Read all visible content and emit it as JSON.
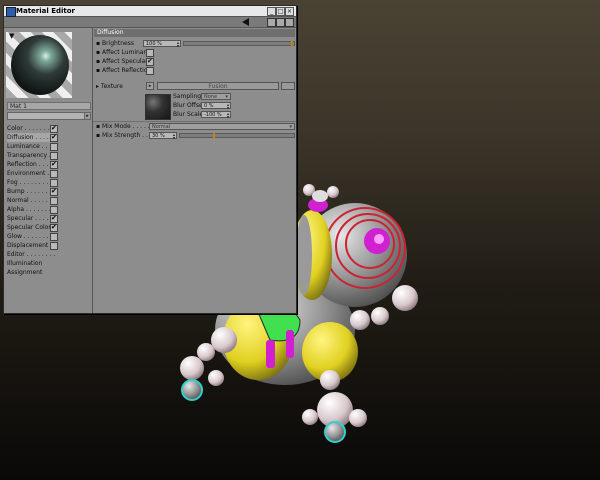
{
  "window": {
    "title": "Material Editor"
  },
  "material": {
    "name": "Mat 1"
  },
  "channels": [
    {
      "label": "Color . . . . . . . .",
      "checked": true
    },
    {
      "label": "Diffusion . . . . .",
      "checked": true,
      "active": true
    },
    {
      "label": "Luminance . . . .",
      "checked": false
    },
    {
      "label": "Transparency . .",
      "checked": false
    },
    {
      "label": "Reflection . . . .",
      "checked": true
    },
    {
      "label": "Environment . .",
      "checked": false
    },
    {
      "label": "Fog . . . . . . . . .",
      "checked": false
    },
    {
      "label": "Bump . . . . . . . .",
      "checked": true
    },
    {
      "label": "Normal . . . . . . .",
      "checked": false
    },
    {
      "label": "Alpha . . . . . . . .",
      "checked": false
    },
    {
      "label": "Specular . . . . . .",
      "checked": true
    },
    {
      "label": "Specular Color",
      "checked": true
    },
    {
      "label": "Glow . . . . . . . .",
      "checked": false
    },
    {
      "label": "Displacement",
      "checked": false
    },
    {
      "label": "Editor . . . . . . . ."
    },
    {
      "label": "Illumination"
    },
    {
      "label": "Assignment"
    }
  ],
  "diffusion": {
    "header": "Diffusion",
    "brightness_label": "Brightness",
    "brightness_value": "100 %",
    "brightness_fraction": 1.0,
    "affect_luminance_label": "Affect Luminance",
    "affect_luminance": false,
    "affect_specular_label": "Affect Specular",
    "affect_specular": true,
    "affect_reflection_label": "Affect Reflection",
    "affect_reflection": false,
    "texture_label": "Texture",
    "texture_name": "Fusion",
    "texture_btn": "...",
    "texture_menu_btn": "▸",
    "sampling_label": "Sampling",
    "sampling_value": "None",
    "blur_offset_label": "Blur Offset",
    "blur_offset_value": "0 %",
    "blur_scale_label": "Blur Scale",
    "blur_scale_value": "-100 %",
    "mix_mode_label": "Mix Mode . . . . . .",
    "mix_mode_value": "Normal",
    "mix_strength_label": "Mix Strength . .",
    "mix_strength_value": "30 %",
    "mix_strength_fraction": 0.3
  },
  "colors": {
    "panel_bg": "#8d8d8d",
    "slider_thumb": "#d08000",
    "robot_body": "#9a9a9a",
    "robot_red": "#cc2233",
    "robot_magenta": "#d020d0",
    "robot_yellow": "#e0d020",
    "robot_green": "#40e050",
    "robot_cyan": "#30d0d0"
  }
}
